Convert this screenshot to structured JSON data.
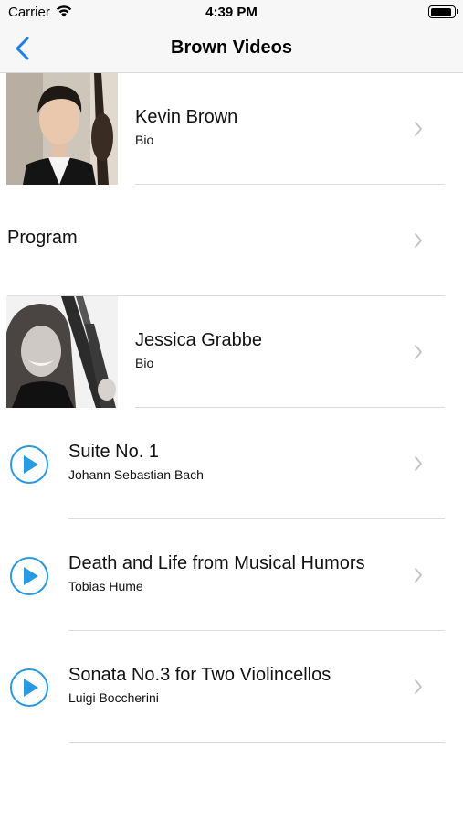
{
  "status_bar": {
    "carrier": "Carrier",
    "time": "4:39 PM",
    "battery_level": 0.9
  },
  "nav": {
    "title": "Brown Videos",
    "back_icon": "chevron-left-icon",
    "accent_color": "#1a7fe8"
  },
  "rows": [
    {
      "title": "Kevin Brown",
      "subtitle": "Bio",
      "kind": "bio"
    },
    {
      "title": "Program",
      "kind": "plain"
    },
    {
      "title": "Jessica Grabbe",
      "subtitle": "Bio",
      "kind": "bio"
    },
    {
      "title": "Suite No. 1",
      "subtitle": "Johann Sebastian Bach",
      "kind": "video",
      "icon": "play-icon"
    },
    {
      "title": "Death and Life from Musical Humors",
      "subtitle": "Tobias Hume",
      "kind": "video",
      "icon": "play-icon"
    },
    {
      "title": "Sonata No.3 for Two Violincellos",
      "subtitle": "Luigi Boccherini",
      "kind": "video",
      "icon": "play-icon"
    }
  ],
  "colors": {
    "play_icon": "#2a9ae0",
    "chevron": "#c4c4c9",
    "separator": "#dcdcdc"
  }
}
